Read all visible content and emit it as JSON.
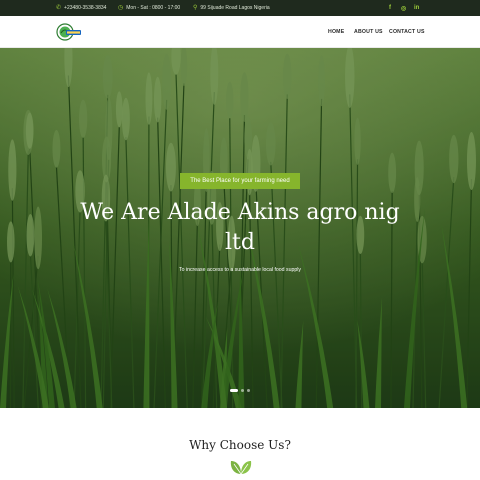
{
  "topbar": {
    "phone": "+23480-3538-3834",
    "hours": "Mon - Sat : 0800 - 17:00",
    "address": "99 Sijuade Road Lagos Nigeria",
    "social": [
      "f",
      "◎",
      "in"
    ]
  },
  "nav": {
    "logo_text": "Alade Akins",
    "items": [
      {
        "label": "HOME"
      },
      {
        "label": "ABOUT US"
      },
      {
        "label": "CONTACT US"
      }
    ]
  },
  "hero": {
    "tagline": "The Best Place for your farming need",
    "title_line1": "We Are Alade Akins agro nig",
    "title_line2": "ltd",
    "subtitle": "To increase access to a sustainable local food supply"
  },
  "why": {
    "title": "Why Choose Us?"
  },
  "colors": {
    "accent": "#86b52c",
    "topbar_bg": "#1f2a1e",
    "hero_green": "#3e6a24"
  }
}
